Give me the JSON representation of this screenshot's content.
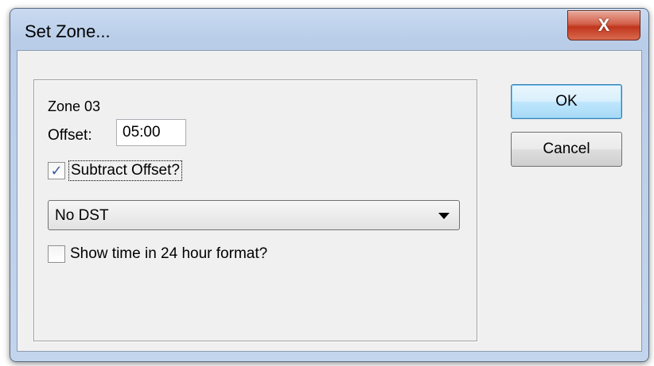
{
  "window": {
    "title": "Set Zone...",
    "close_glyph": "X"
  },
  "zone": {
    "label": "Zone 03"
  },
  "offset": {
    "label": "Offset:",
    "value": "05:00"
  },
  "subtract_offset": {
    "label": "Subtract Offset?",
    "checked": true,
    "check_glyph": "✓"
  },
  "dst": {
    "selected": "No DST"
  },
  "time_format": {
    "label": "Show time in 24 hour format?",
    "checked": false,
    "check_glyph": ""
  },
  "buttons": {
    "ok": "OK",
    "cancel": "Cancel"
  },
  "icons": {
    "close": "close-icon",
    "dropdown": "chevron-down-icon",
    "check": "checkmark-icon"
  }
}
